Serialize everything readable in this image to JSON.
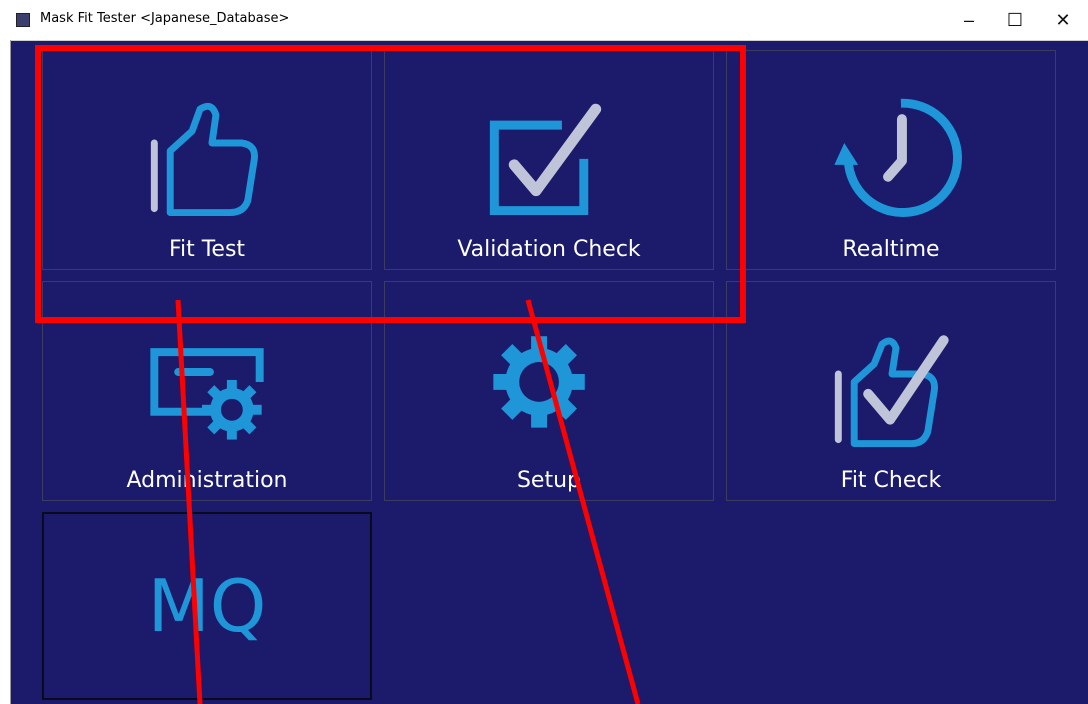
{
  "window": {
    "title": "Mask Fit Tester <Japanese_Database>"
  },
  "controls": {
    "minimize": "–",
    "maximize": "☐",
    "close": "✕"
  },
  "tiles": [
    {
      "label": "Fit Test",
      "icon": "thumbs-up-icon"
    },
    {
      "label": "Validation Check",
      "icon": "checkbox-icon"
    },
    {
      "label": "Realtime",
      "icon": "clock-refresh-icon"
    },
    {
      "label": "Administration",
      "icon": "admin-card-gear-icon"
    },
    {
      "label": "Setup",
      "icon": "gear-icon"
    },
    {
      "label": "Fit Check",
      "icon": "thumbs-up-check-icon"
    },
    {
      "label": "MQ",
      "icon": "mq-text"
    }
  ],
  "colors": {
    "background": "#1b1a6b",
    "icon_blue": "#1e96d8",
    "icon_gray": "#c0c4d8",
    "annotation_red": "#ff0000"
  }
}
